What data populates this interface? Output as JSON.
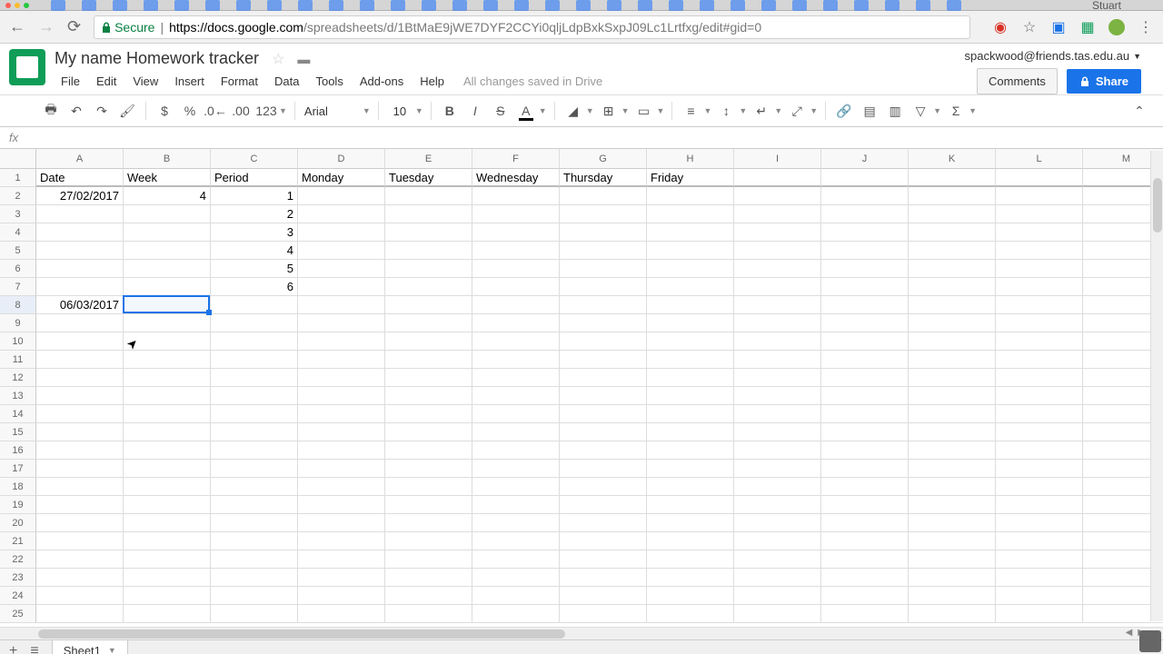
{
  "browser": {
    "user_label": "Stuart",
    "url_secure": "Secure",
    "url_host": "https://docs.google.com",
    "url_path": "/spreadsheets/d/1BtMaE9jWE7DYF2CCYi0qljLdpBxkSxpJ09Lc1Lrtfxg/edit#gid=0"
  },
  "header": {
    "title": "My name Homework tracker",
    "user_email": "spackwood@friends.tas.edu.au",
    "comments_label": "Comments",
    "share_label": "Share",
    "saved_text": "All changes saved in Drive",
    "menu": [
      "File",
      "Edit",
      "View",
      "Insert",
      "Format",
      "Data",
      "Tools",
      "Add-ons",
      "Help"
    ]
  },
  "toolbar": {
    "font_name": "Arial",
    "font_size": "10",
    "format_123": "123"
  },
  "formula": {
    "fx": "fx",
    "value": ""
  },
  "columns": [
    "A",
    "B",
    "C",
    "D",
    "E",
    "F",
    "G",
    "H",
    "I",
    "J",
    "K",
    "L",
    "M"
  ],
  "rows": [
    1,
    2,
    3,
    4,
    5,
    6,
    7,
    8,
    9,
    10,
    11,
    12,
    13,
    14,
    15,
    16,
    17,
    18,
    19,
    20,
    21,
    22,
    23,
    24,
    25
  ],
  "cells": {
    "r1": {
      "A": "Date",
      "B": "Week",
      "C": "Period",
      "D": "Monday",
      "E": "Tuesday",
      "F": "Wednesday",
      "G": "Thursday",
      "H": "Friday"
    },
    "r2": {
      "A": "27/02/2017",
      "B": "4",
      "C": "1"
    },
    "r3": {
      "C": "2"
    },
    "r4": {
      "C": "3"
    },
    "r5": {
      "C": "4"
    },
    "r6": {
      "C": "5"
    },
    "r7": {
      "C": "6"
    },
    "r8": {
      "A": "06/03/2017"
    }
  },
  "selected_cell": {
    "row": 8,
    "col": "B"
  },
  "sheet_tabs": {
    "active": "Sheet1"
  }
}
